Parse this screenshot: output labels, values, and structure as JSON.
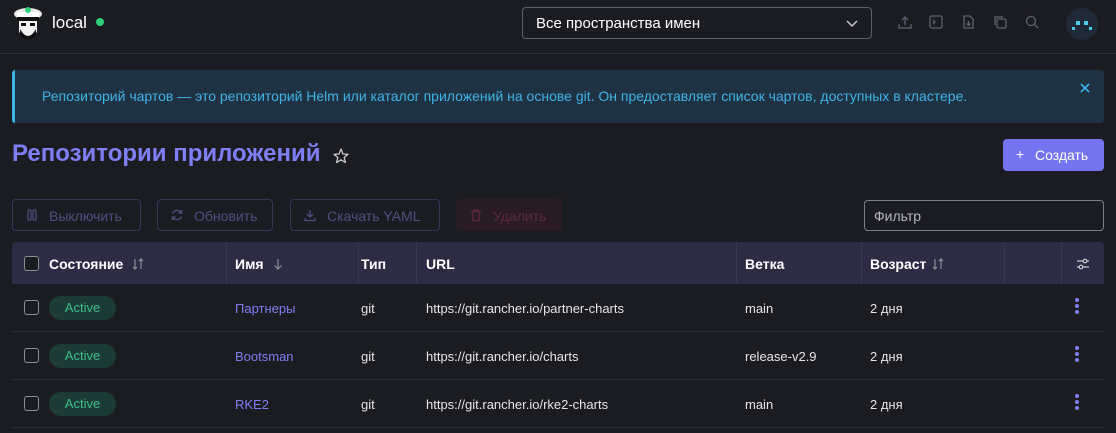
{
  "header": {
    "cluster_name": "local",
    "namespace_selected": "Все пространства имен"
  },
  "banner": {
    "text": "Репозиторий чартов — это репозиторий Helm или каталог приложений на основе git. Он предоставляет список чартов, доступных в кластере."
  },
  "page": {
    "title": "Репозитории приложений",
    "create_label": "Создать"
  },
  "toolbar": {
    "disable_label": "Выключить",
    "refresh_label": "Обновить",
    "download_label": "Скачать YAML",
    "delete_label": "Удалить",
    "filter_placeholder": "Фильтр"
  },
  "table": {
    "columns": {
      "state": "Состояние",
      "name": "Имя",
      "type": "Тип",
      "url": "URL",
      "branch": "Ветка",
      "age": "Возраст"
    },
    "rows": [
      {
        "state": "Active",
        "name": "Партнеры",
        "type": "git",
        "url": "https://git.rancher.io/partner-charts",
        "branch": "main",
        "age": "2 дня"
      },
      {
        "state": "Active",
        "name": "Bootsman",
        "type": "git",
        "url": "https://git.rancher.io/charts",
        "branch": "release-v2.9",
        "age": "2 дня"
      },
      {
        "state": "Active",
        "name": "RKE2",
        "type": "git",
        "url": "https://git.rancher.io/rke2-charts",
        "branch": "main",
        "age": "2 дня"
      }
    ]
  },
  "colors": {
    "accent": "#7474f0",
    "info": "#3fb3e8",
    "active_badge_bg": "#1d3b36",
    "active_badge_text": "#3fbf8e",
    "status_online": "#2fcf7e"
  },
  "icons": {
    "logo": "bootsman-logo",
    "namespace_chevron": "chevron-down-icon",
    "header_actions": [
      "upload-icon",
      "terminal-icon",
      "download-file-icon",
      "copy-icon",
      "search-icon"
    ],
    "banner_close": "close-icon",
    "favorite": "star-icon",
    "column_settings": "sliders-icon",
    "row_actions": "more-vertical-icon"
  }
}
